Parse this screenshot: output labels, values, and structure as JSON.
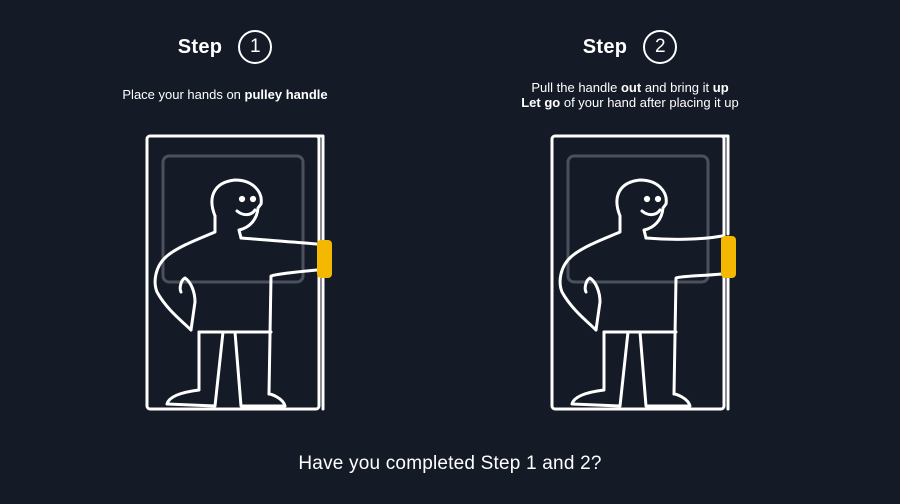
{
  "steps": [
    {
      "label": "Step",
      "number": "1",
      "instruction": {
        "line1_pre": "Place your hands on ",
        "line1_bold": "pulley handle"
      }
    },
    {
      "label": "Step",
      "number": "2",
      "instruction": {
        "line1_pre": "Pull the handle ",
        "line1_bold1": "out",
        "line1_mid": " and bring it ",
        "line1_bold2": "up",
        "line2_bold": "Let go",
        "line2_post": " of your hand after placing it up"
      }
    }
  ],
  "question": "Have you completed Step 1 and 2?",
  "colors": {
    "background": "#141a26",
    "line": "#ffffff",
    "frame_inner": "#4a505c",
    "handle": "#f5b800"
  }
}
